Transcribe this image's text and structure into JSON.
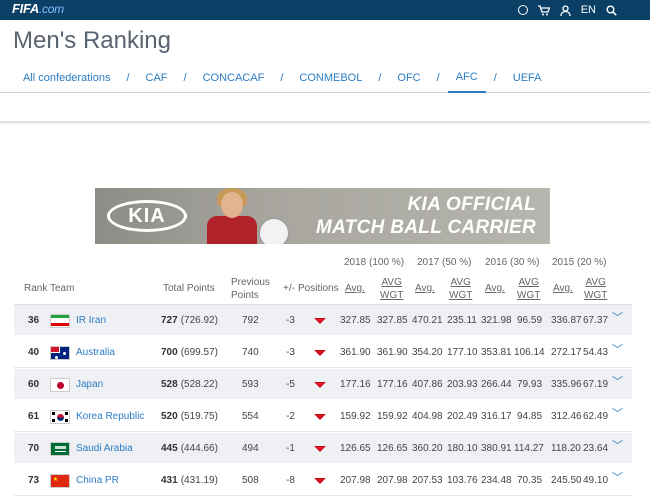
{
  "header": {
    "logo_main": "FIFA",
    "logo_suffix": ".com",
    "language": "EN"
  },
  "page_title": "Men's Ranking",
  "confederations": [
    {
      "label": "All confederations",
      "active": false
    },
    {
      "label": "CAF",
      "active": false
    },
    {
      "label": "CONCACAF",
      "active": false
    },
    {
      "label": "CONMEBOL",
      "active": false
    },
    {
      "label": "OFC",
      "active": false
    },
    {
      "label": "AFC",
      "active": true
    },
    {
      "label": "UEFA",
      "active": false
    }
  ],
  "nav_separator": "/",
  "banner": {
    "brand": "KIA",
    "line1": "KIA OFFICIAL",
    "line2": "MATCH BALL CARRIER"
  },
  "table": {
    "headers": {
      "rank": "Rank",
      "team": "Team",
      "total_points": "Total Points",
      "previous_points_1": "Previous",
      "previous_points_2": "Points",
      "change": "+/-",
      "positions": "Positions",
      "y2018": "2018 (100 %)",
      "y2017": "2017 (50 %)",
      "y2016": "2016 (30 %)",
      "y2015": "2015 (20 %)",
      "avg": "Avg.",
      "avg_wgt_1": "AVG",
      "avg_wgt_2": "WGT"
    },
    "rows": [
      {
        "rank": "36",
        "team": "IR Iran",
        "flag": "iran",
        "total": "727",
        "total_detail": "(726.92)",
        "previous": "792",
        "change": "-3",
        "y2018_avg": "327.85",
        "y2018_wgt": "327.85",
        "y2017_avg": "470.21",
        "y2017_wgt": "235.11",
        "y2016_avg": "321.98",
        "y2016_wgt": "96.59",
        "y2015_avg": "336.87",
        "y2015_wgt": "67.37"
      },
      {
        "rank": "40",
        "team": "Australia",
        "flag": "aus",
        "total": "700",
        "total_detail": "(699.57)",
        "previous": "740",
        "change": "-3",
        "y2018_avg": "361.90",
        "y2018_wgt": "361.90",
        "y2017_avg": "354.20",
        "y2017_wgt": "177.10",
        "y2016_avg": "353.81",
        "y2016_wgt": "106.14",
        "y2015_avg": "272.17",
        "y2015_wgt": "54.43"
      },
      {
        "rank": "60",
        "team": "Japan",
        "flag": "jpn",
        "total": "528",
        "total_detail": "(528.22)",
        "previous": "593",
        "change": "-5",
        "y2018_avg": "177.16",
        "y2018_wgt": "177.16",
        "y2017_avg": "407.86",
        "y2017_wgt": "203.93",
        "y2016_avg": "266.44",
        "y2016_wgt": "79.93",
        "y2015_avg": "335.96",
        "y2015_wgt": "67.19"
      },
      {
        "rank": "61",
        "team": "Korea Republic",
        "flag": "kor",
        "total": "520",
        "total_detail": "(519.75)",
        "previous": "554",
        "change": "-2",
        "y2018_avg": "159.92",
        "y2018_wgt": "159.92",
        "y2017_avg": "404.98",
        "y2017_wgt": "202.49",
        "y2016_avg": "316.17",
        "y2016_wgt": "94.85",
        "y2015_avg": "312.46",
        "y2015_wgt": "62.49"
      },
      {
        "rank": "70",
        "team": "Saudi Arabia",
        "flag": "ksa",
        "total": "445",
        "total_detail": "(444.66)",
        "previous": "494",
        "change": "-1",
        "y2018_avg": "126.65",
        "y2018_wgt": "126.65",
        "y2017_avg": "360.20",
        "y2017_wgt": "180.10",
        "y2016_avg": "380.91",
        "y2016_wgt": "114.27",
        "y2015_avg": "118.20",
        "y2015_wgt": "23.64"
      },
      {
        "rank": "73",
        "team": "China PR",
        "flag": "chn",
        "total": "431",
        "total_detail": "(431.19)",
        "previous": "508",
        "change": "-8",
        "y2018_avg": "207.98",
        "y2018_wgt": "207.98",
        "y2017_avg": "207.53",
        "y2017_wgt": "103.76",
        "y2016_avg": "234.48",
        "y2016_wgt": "70.35",
        "y2015_avg": "245.50",
        "y2015_wgt": "49.10"
      }
    ]
  },
  "colors": {
    "topbar": "#0b3f66",
    "link": "#2b7cc4",
    "down_arrow": "#d0121b",
    "row_alt": "#eef0f3"
  },
  "icons": [
    "football-icon",
    "cart-icon",
    "user-icon",
    "search-icon",
    "menu-icon",
    "down-arrow-icon",
    "expand-icon"
  ]
}
